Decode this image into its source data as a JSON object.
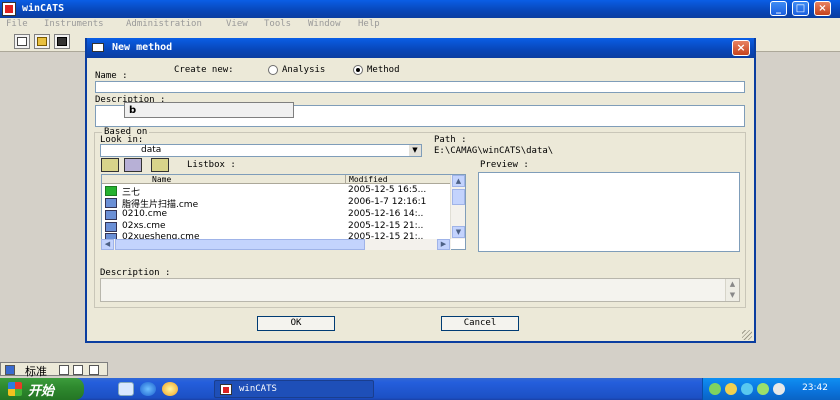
{
  "app": {
    "title": "winCATS",
    "controls": {
      "minimize": "_",
      "maximize": "□",
      "close": "×"
    }
  },
  "menu": [
    "File",
    "Instruments",
    "Administration",
    "View",
    "Tools",
    "Window",
    "Help"
  ],
  "toolbar": {
    "buttons": [
      {
        "icon": "new-file-icon"
      },
      {
        "icon": "open-folder-icon"
      },
      {
        "icon": "save-icon"
      }
    ]
  },
  "dialog": {
    "title": "New method",
    "close": "×",
    "create_new_label": "Create new:",
    "radio_analysis": "Analysis",
    "radio_method": "Method",
    "selected_create": "Method",
    "name_label": "Name :",
    "name_value": "",
    "description_label": "Description :",
    "autocomplete": "b",
    "based_on_label": "Based on",
    "look_in_label": "Look in:",
    "look_in_value": "data",
    "path_label": "Path :",
    "path_value": "E:\\CAMAG\\winCATS\\data\\",
    "listbox_label": "Listbox :",
    "preview_label": "Preview :",
    "list_columns": [
      "Name",
      "Modified"
    ],
    "files": [
      {
        "name": "三七",
        "modified": "2005-12-5 16:5...",
        "type": "folder"
      },
      {
        "name": "脂得生片扫描.cme",
        "modified": "2006-1-7 12:16:1",
        "type": "file"
      },
      {
        "name": "0210.cme",
        "modified": "2005-12-16 14:..",
        "type": "file"
      },
      {
        "name": "02xs.cme",
        "modified": "2005-12-15 21:..",
        "type": "file"
      },
      {
        "name": "02xuesheng.cme",
        "modified": "2005-12-15 21:..",
        "type": "file"
      }
    ],
    "description2_label": "Description :",
    "ok": "OK",
    "cancel": "Cancel"
  },
  "ime": {
    "text": "标准"
  },
  "taskbar": {
    "start": "开始",
    "task_title": "winCATS",
    "clock": "23:42"
  },
  "colors": {
    "titlebar": "#0846b8",
    "start_green": "#2f8a2f",
    "taskbar_blue": "#245edc",
    "folder_green": "#25b230"
  }
}
